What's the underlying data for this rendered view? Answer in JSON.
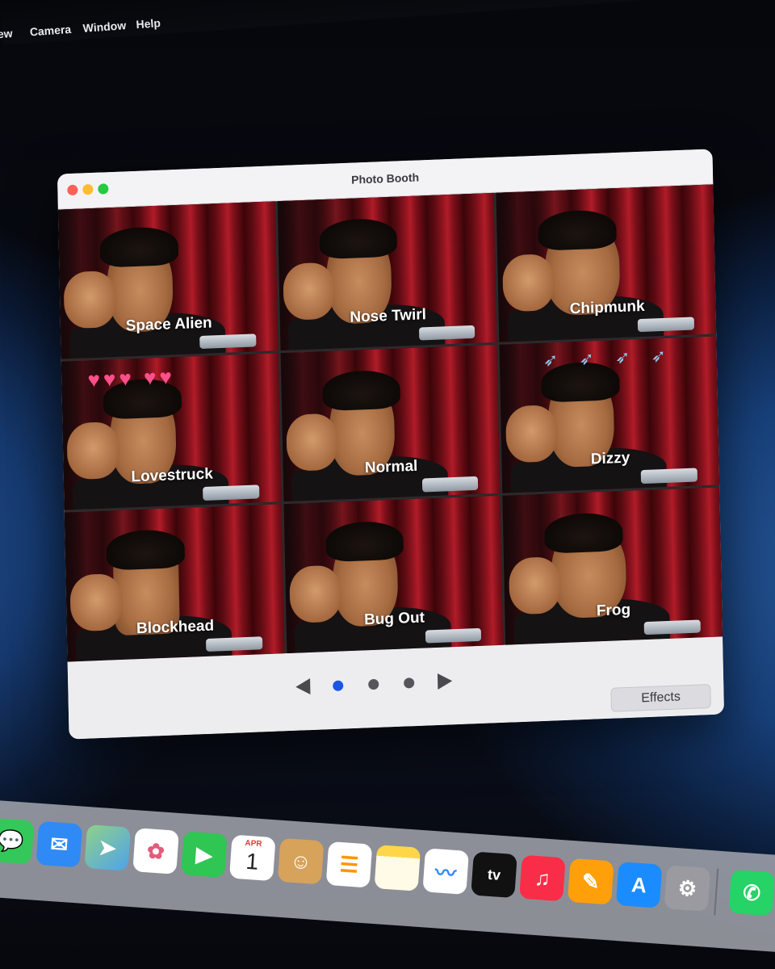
{
  "menubar": {
    "items": [
      "ew",
      "Camera",
      "Window",
      "Help"
    ]
  },
  "window": {
    "title": "Photo Booth",
    "effects": [
      {
        "label": "Space Alien"
      },
      {
        "label": "Nose Twirl"
      },
      {
        "label": "Chipmunk"
      },
      {
        "label": "Lovestruck"
      },
      {
        "label": "Normal"
      },
      {
        "label": "Dizzy"
      },
      {
        "label": "Blockhead"
      },
      {
        "label": "Bug Out"
      },
      {
        "label": "Frog"
      }
    ],
    "pagination": {
      "pages": 3,
      "current": 1
    },
    "effects_button_label": "Effects"
  },
  "dock": {
    "calendar": {
      "month": "APR",
      "day": "1"
    },
    "apps": [
      {
        "name": "Messages",
        "icon": "messages-icon",
        "color": "#34c759"
      },
      {
        "name": "Mail",
        "icon": "mail-icon",
        "color": "#2f8af5"
      },
      {
        "name": "Maps",
        "icon": "maps-icon",
        "color": "#5ac26b"
      },
      {
        "name": "Photos",
        "icon": "photos-icon",
        "color": "#ffffff"
      },
      {
        "name": "FaceTime",
        "icon": "facetime-icon",
        "color": "#2fc653"
      },
      {
        "name": "Calendar",
        "icon": "calendar-icon",
        "color": "#ffffff"
      },
      {
        "name": "Contacts",
        "icon": "contacts-icon",
        "color": "#d7a25a"
      },
      {
        "name": "Reminders",
        "icon": "reminders-icon",
        "color": "#ffffff"
      },
      {
        "name": "Notes",
        "icon": "notes-icon",
        "color": "#ffd64a"
      },
      {
        "name": "Freeform",
        "icon": "freeform-icon",
        "color": "#ffffff"
      },
      {
        "name": "TV",
        "icon": "tv-icon",
        "color": "#111111"
      },
      {
        "name": "Music",
        "icon": "music-icon",
        "color": "#fa2d48"
      },
      {
        "name": "Pages",
        "icon": "pages-icon",
        "color": "#ff9f0a"
      },
      {
        "name": "App Store",
        "icon": "app-store-icon",
        "color": "#1a8cff"
      },
      {
        "name": "System Settings",
        "icon": "system-settings-icon",
        "color": "#9a9aa0"
      },
      {
        "name": "WhatsApp",
        "icon": "whatsapp-icon",
        "color": "#25d366"
      }
    ],
    "tv_label": "tv"
  }
}
